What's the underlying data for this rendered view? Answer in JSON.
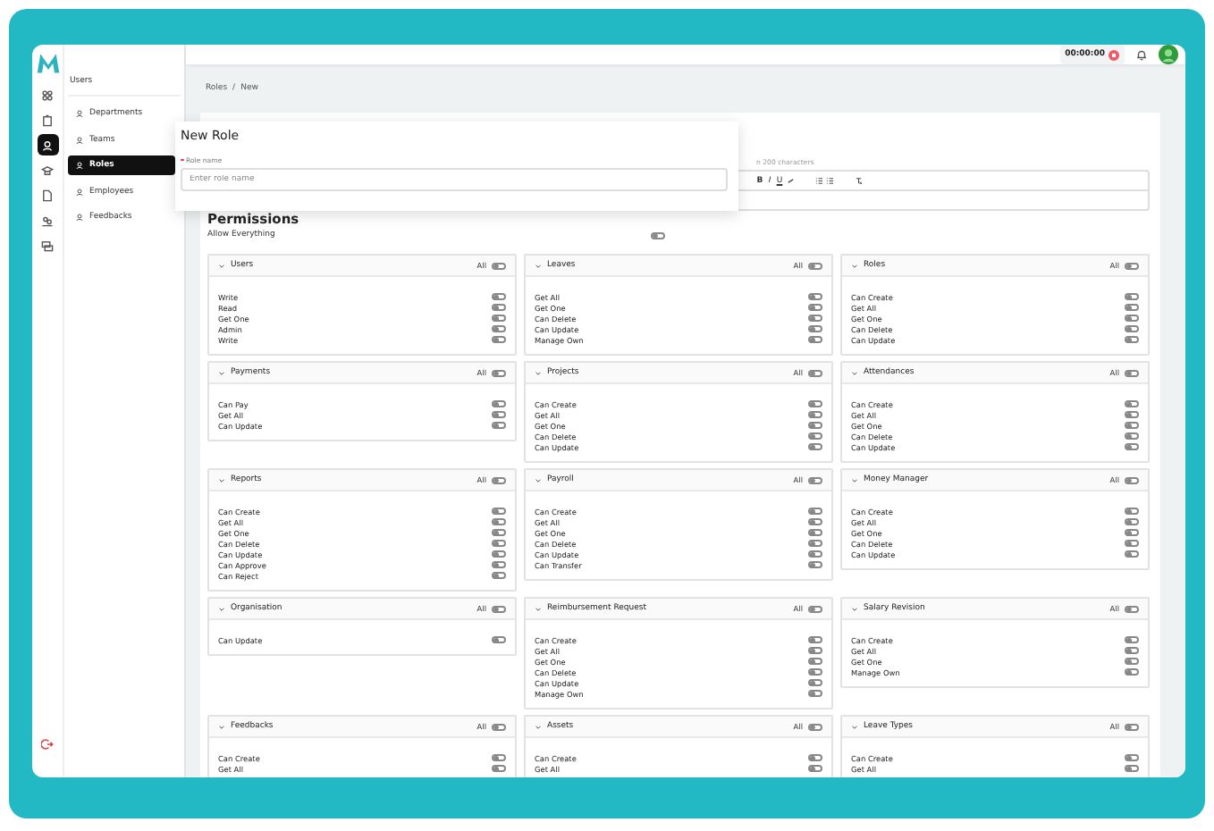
{
  "rail_items": [
    {
      "selected": false
    },
    {
      "selected": false
    },
    {
      "selected": true
    },
    {
      "selected": false
    },
    {
      "selected": false
    },
    {
      "selected": false
    },
    {
      "selected": false
    }
  ],
  "sidebar": {
    "heading": "Users",
    "items": [
      {
        "label": "Departments",
        "selected": false
      },
      {
        "label": "Teams",
        "selected": false
      },
      {
        "label": "Roles",
        "selected": true
      },
      {
        "label": "Employees",
        "selected": false
      },
      {
        "label": "Feedbacks",
        "selected": false
      }
    ]
  },
  "top_bar": {
    "timer": "00:00:00"
  },
  "breadcrumb": [
    "Roles",
    "/",
    "New"
  ],
  "description": {
    "label": "n 200 characters",
    "toolbar": [
      "B",
      "I",
      "U"
    ]
  },
  "dialog": {
    "title": "New Role",
    "field_label": "Role name",
    "placeholder": "Enter role name"
  },
  "permissions": {
    "title": "Permissions",
    "allow_everything": {
      "label": "Allow Everything",
      "on": false
    },
    "groups": [
      {
        "name": "Users",
        "all_label": "All",
        "all_on": false,
        "items": [
          {
            "label": "Write",
            "on": false
          },
          {
            "label": "Read",
            "on": false
          },
          {
            "label": "Get One",
            "on": false
          },
          {
            "label": "Admin",
            "on": false
          },
          {
            "label": "Write",
            "on": false
          }
        ]
      },
      {
        "name": "Leaves",
        "all_label": "All",
        "all_on": false,
        "items": [
          {
            "label": "Get All",
            "on": false
          },
          {
            "label": "Get One",
            "on": false
          },
          {
            "label": "Can Delete",
            "on": false
          },
          {
            "label": "Can Update",
            "on": false
          },
          {
            "label": "Manage Own",
            "on": false
          }
        ]
      },
      {
        "name": "Roles",
        "all_label": "All",
        "all_on": false,
        "items": [
          {
            "label": "Can Create",
            "on": false
          },
          {
            "label": "Get All",
            "on": false
          },
          {
            "label": "Get One",
            "on": false
          },
          {
            "label": "Can Delete",
            "on": false
          },
          {
            "label": "Can Update",
            "on": false
          }
        ]
      },
      {
        "name": "Payments",
        "all_label": "All",
        "all_on": false,
        "items": [
          {
            "label": "Can Pay",
            "on": false
          },
          {
            "label": "Get All",
            "on": false
          },
          {
            "label": "Can Update",
            "on": false
          }
        ]
      },
      {
        "name": "Projects",
        "all_label": "All",
        "all_on": false,
        "items": [
          {
            "label": "Can Create",
            "on": false
          },
          {
            "label": "Get All",
            "on": false
          },
          {
            "label": "Get One",
            "on": false
          },
          {
            "label": "Can Delete",
            "on": false
          },
          {
            "label": "Can Update",
            "on": false
          }
        ]
      },
      {
        "name": "Attendances",
        "all_label": "All",
        "all_on": false,
        "items": [
          {
            "label": "Can Create",
            "on": false
          },
          {
            "label": "Get All",
            "on": false
          },
          {
            "label": "Get One",
            "on": false
          },
          {
            "label": "Can Delete",
            "on": false
          },
          {
            "label": "Can Update",
            "on": false
          }
        ]
      },
      {
        "name": "Reports",
        "all_label": "All",
        "all_on": false,
        "items": [
          {
            "label": "Can Create",
            "on": false
          },
          {
            "label": "Get All",
            "on": false
          },
          {
            "label": "Get One",
            "on": false
          },
          {
            "label": "Can Delete",
            "on": false
          },
          {
            "label": "Can Update",
            "on": false
          },
          {
            "label": "Can Approve",
            "on": false
          },
          {
            "label": "Can Reject",
            "on": false
          }
        ]
      },
      {
        "name": "Payroll",
        "all_label": "All",
        "all_on": false,
        "items": [
          {
            "label": "Can Create",
            "on": false
          },
          {
            "label": "Get All",
            "on": false
          },
          {
            "label": "Get One",
            "on": false
          },
          {
            "label": "Can Delete",
            "on": false
          },
          {
            "label": "Can Update",
            "on": false
          },
          {
            "label": "Can Transfer",
            "on": false
          }
        ]
      },
      {
        "name": "Money Manager",
        "all_label": "All",
        "all_on": false,
        "items": [
          {
            "label": "Can Create",
            "on": false
          },
          {
            "label": "Get All",
            "on": false
          },
          {
            "label": "Get One",
            "on": false
          },
          {
            "label": "Can Delete",
            "on": false
          },
          {
            "label": "Can Update",
            "on": false
          }
        ]
      },
      {
        "name": "Organisation",
        "all_label": "All",
        "all_on": false,
        "items": [
          {
            "label": "Can Update",
            "on": false
          }
        ]
      },
      {
        "name": "Reimbursement Request",
        "all_label": "All",
        "all_on": false,
        "items": [
          {
            "label": "Can Create",
            "on": false
          },
          {
            "label": "Get All",
            "on": false
          },
          {
            "label": "Get One",
            "on": false
          },
          {
            "label": "Can Delete",
            "on": false
          },
          {
            "label": "Can Update",
            "on": false
          },
          {
            "label": "Manage Own",
            "on": false
          }
        ]
      },
      {
        "name": "Salary Revision",
        "all_label": "All",
        "all_on": false,
        "items": [
          {
            "label": "Can Create",
            "on": false
          },
          {
            "label": "Get All",
            "on": false
          },
          {
            "label": "Get One",
            "on": false
          },
          {
            "label": "Manage Own",
            "on": false
          }
        ]
      },
      {
        "name": "Feedbacks",
        "all_label": "All",
        "all_on": false,
        "items": [
          {
            "label": "Can Create",
            "on": false
          },
          {
            "label": "Get All",
            "on": false
          }
        ]
      },
      {
        "name": "Assets",
        "all_label": "All",
        "all_on": false,
        "items": [
          {
            "label": "Can Create",
            "on": false
          },
          {
            "label": "Get All",
            "on": false
          }
        ]
      },
      {
        "name": "Leave Types",
        "all_label": "All",
        "all_on": false,
        "items": [
          {
            "label": "Can Create",
            "on": false
          },
          {
            "label": "Get All",
            "on": false
          }
        ]
      }
    ]
  }
}
